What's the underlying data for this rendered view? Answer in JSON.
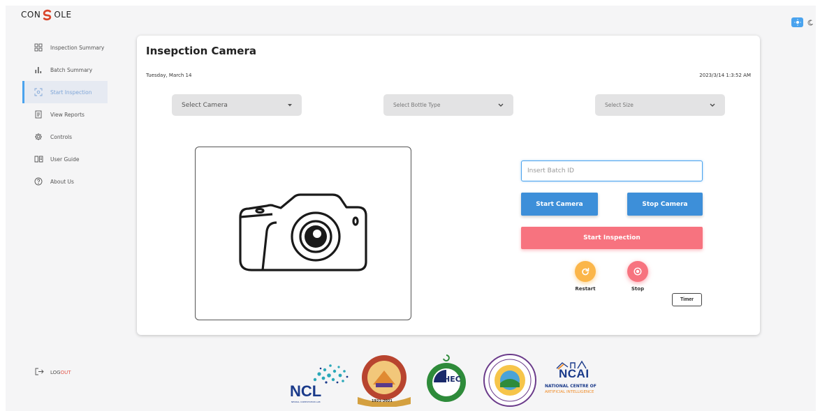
{
  "brand": {
    "prefix": "CON",
    "suffix": "OLE"
  },
  "sidebar": {
    "items": [
      {
        "label": "Inspection Summary",
        "icon": "grid-icon"
      },
      {
        "label": "Batch Summary",
        "icon": "bar-chart-icon"
      },
      {
        "label": "Start Inspection",
        "icon": "scan-icon",
        "active": true
      },
      {
        "label": "View Reports",
        "icon": "report-icon"
      },
      {
        "label": "Controls",
        "icon": "gear-icon"
      },
      {
        "label": "User Guide",
        "icon": "book-icon"
      },
      {
        "label": "About Us",
        "icon": "help-icon"
      }
    ],
    "logout": {
      "lead": "LOG",
      "accent": "OUT"
    }
  },
  "main": {
    "title": "Insepction Camera",
    "date_left": "Tuesday, March 14",
    "date_right": "2023/3/14 1:3:52 AM",
    "selects": {
      "camera": "Select Camera",
      "bottle": "Select Bottle Type",
      "size": "Select Size"
    },
    "batch_placeholder": "Insert Batch ID",
    "buttons": {
      "start_camera": "Start Camera",
      "stop_camera": "Stop Camera",
      "start_inspection": "Start Inspection",
      "restart": "Restart",
      "stop": "Stop",
      "timer": "Timer"
    }
  },
  "logos": {
    "ncl": "NCL",
    "ncl_sub": "NEURAL COMPUTATION LAB",
    "ned_year": "1921-2021",
    "hec": "HEC",
    "ncai": "NCAI",
    "ncai_line1": "NATIONAL CENTRE OF",
    "ncai_line2": "ARTIFICIAL INTELLIGENCE"
  },
  "colors": {
    "accent_blue": "#3d8fd9",
    "danger_pink": "#f7737f",
    "warning_orange": "#fbb64a"
  }
}
